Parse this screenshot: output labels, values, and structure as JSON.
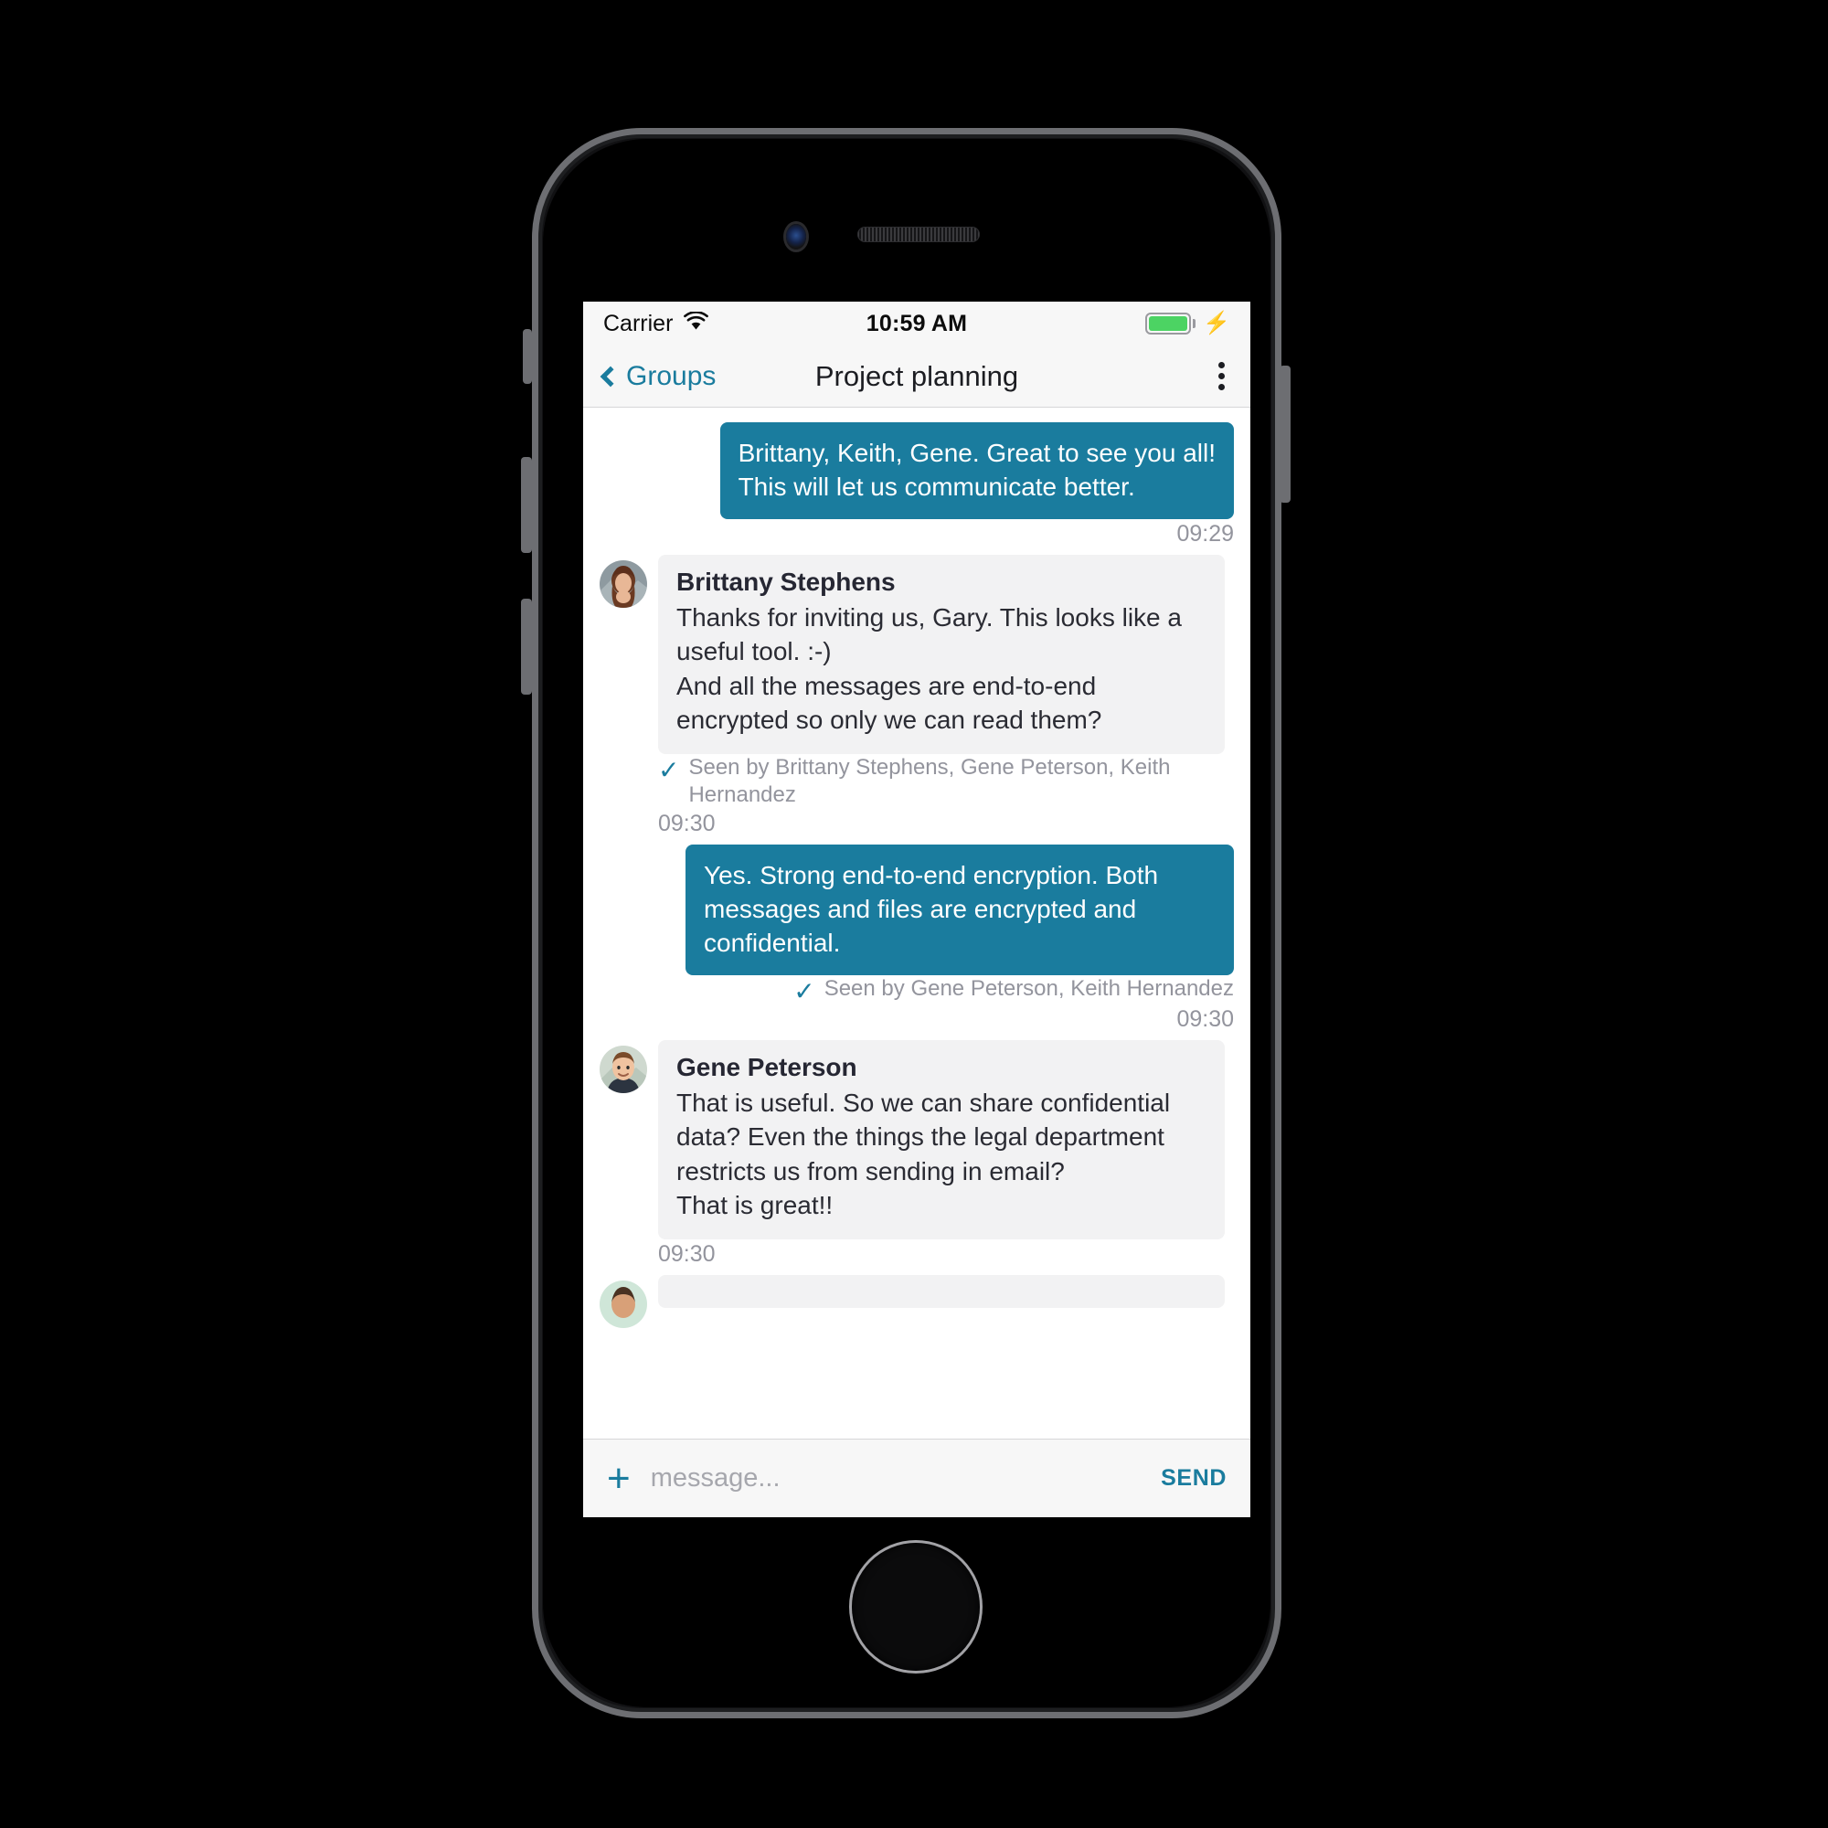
{
  "status_bar": {
    "carrier": "Carrier",
    "wifi_icon": "wifi-icon",
    "time": "10:59 AM",
    "battery_icon": "battery-full-icon",
    "charging_icon": "lightning-bolt-icon"
  },
  "nav": {
    "back_label": "Groups",
    "back_icon": "chevron-left-icon",
    "title": "Project planning",
    "menu_icon": "overflow-menu-icon"
  },
  "messages": [
    {
      "direction": "out",
      "text": "Brittany, Keith, Gene. Great to see you all!\nThis will let us communicate better.",
      "time": "09:29",
      "seen": ""
    },
    {
      "direction": "in",
      "sender": "Brittany Stephens",
      "avatar": "brittany-avatar",
      "text": "Thanks for inviting us, Gary. This looks like a useful tool. :-)\nAnd all the messages are end-to-end encrypted so only we can read them?",
      "seen": "Seen by Brittany Stephens, Gene Peterson, Keith Hernandez",
      "time": "09:30"
    },
    {
      "direction": "out",
      "text": "Yes. Strong end-to-end encryption. Both messages and files are encrypted and confidential.",
      "seen": "Seen by Gene Peterson, Keith Hernandez",
      "time": "09:30"
    },
    {
      "direction": "in",
      "sender": "Gene Peterson",
      "avatar": "gene-avatar",
      "text": "That is useful. So we can share confidential data? Even the things the legal department restricts us from sending in email?\nThat is great!!",
      "seen": "",
      "time": "09:30"
    }
  ],
  "composer": {
    "add_icon": "plus-icon",
    "placeholder": "message...",
    "value": "",
    "send_label": "SEND"
  },
  "colors": {
    "accent": "#1a7c9e",
    "outgoing_bubble": "#1a7c9e",
    "incoming_bubble": "#f2f2f3",
    "battery_green": "#4cd363",
    "muted_text": "#93949d"
  }
}
